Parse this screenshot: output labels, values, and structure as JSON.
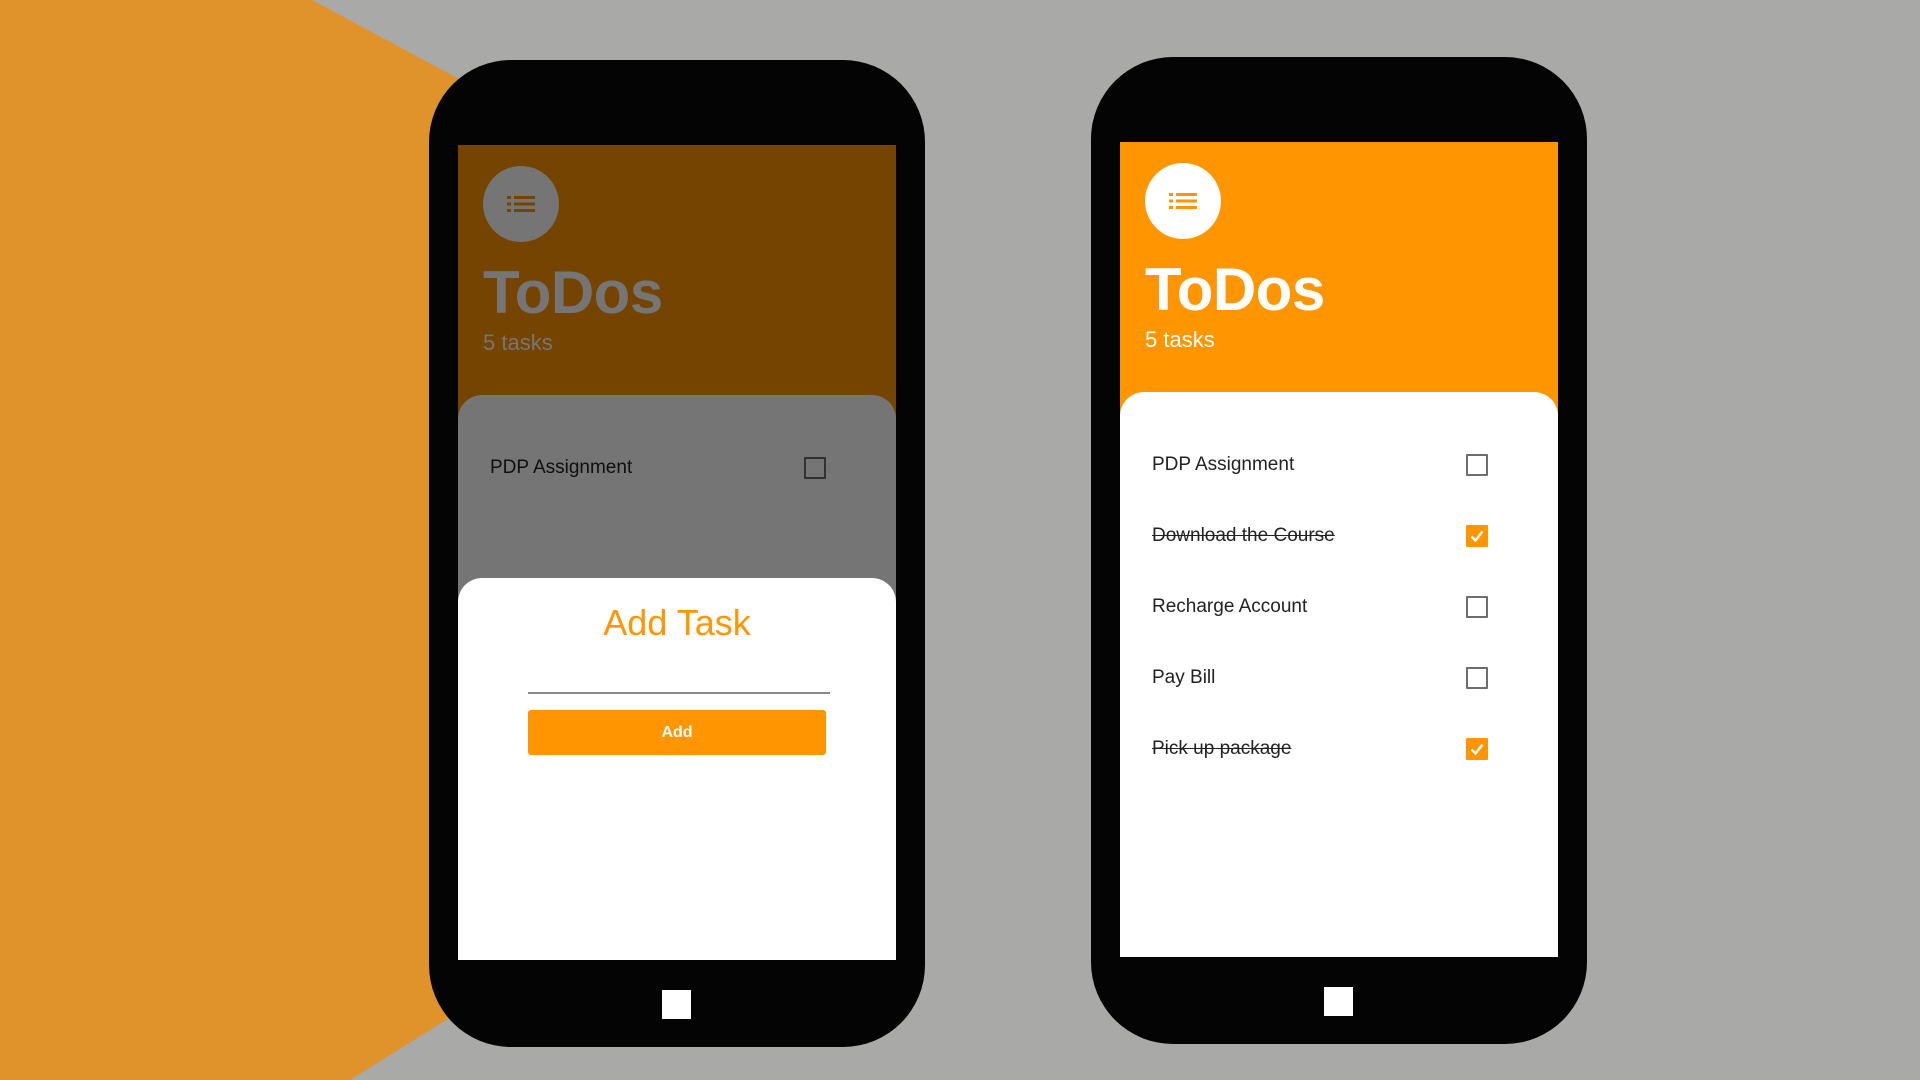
{
  "colors": {
    "accent": "#ff9500",
    "background": "#a9a9a8",
    "decor": "#e0922b"
  },
  "app": {
    "icon": "list-icon",
    "title": "ToDos",
    "task_count": "5 tasks"
  },
  "tasks": [
    {
      "label": "PDP Assignment",
      "done": false
    },
    {
      "label": "Download the Course",
      "done": true
    },
    {
      "label": "Recharge Account",
      "done": false
    },
    {
      "label": "Pay Bill",
      "done": false
    },
    {
      "label": "Pick up package",
      "done": true
    }
  ],
  "add_sheet": {
    "title": "Add Task",
    "input_value": "",
    "button_label": "Add"
  }
}
